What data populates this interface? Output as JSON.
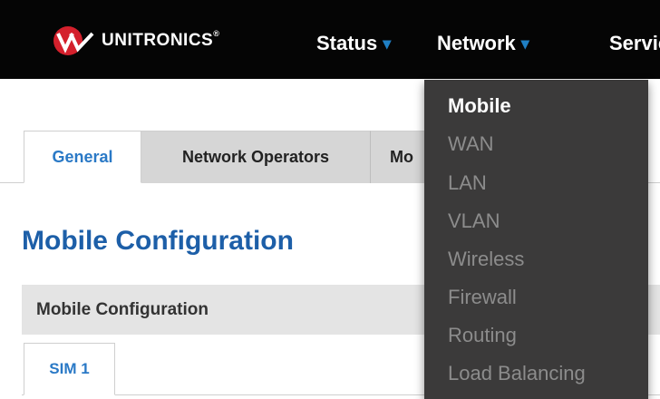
{
  "header": {
    "brand": "UNITRONICS",
    "trademark": "®",
    "logo_icon": "unitronics-logo-icon",
    "nav": [
      {
        "label": "Status",
        "caret": "▾"
      },
      {
        "label": "Network",
        "caret": "▾"
      },
      {
        "label": "Servic"
      }
    ]
  },
  "tabs": [
    "General",
    "Network Operators",
    "Mo"
  ],
  "page_title": "Mobile Configuration",
  "section_header": "Mobile Configuration",
  "subtabs": [
    "SIM 1"
  ],
  "network_menu": {
    "items": [
      {
        "label": "Mobile",
        "active": true
      },
      {
        "label": "WAN"
      },
      {
        "label": "LAN"
      },
      {
        "label": "VLAN"
      },
      {
        "label": "Wireless"
      },
      {
        "label": "Firewall"
      },
      {
        "label": "Routing"
      },
      {
        "label": "Load Balancing"
      }
    ]
  },
  "colors": {
    "topbar": "#050505",
    "accent_blue": "#2a79c6",
    "title_blue": "#1d5fa8",
    "menu_bg": "#3b3a3a",
    "logo_red": "#d4202c"
  }
}
